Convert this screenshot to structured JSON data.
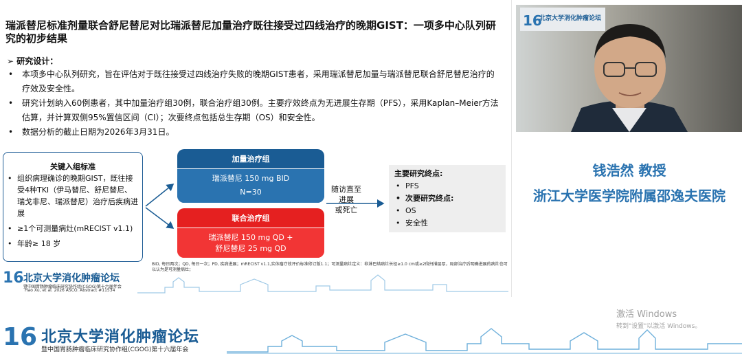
{
  "slide": {
    "title": "瑞派替尼标准剂量联合舒尼替尼对比瑞派替尼加量治疗既往接受过四线治疗的晚期GIST：一项多中心队列研究的初步结果",
    "section_head": "➢ 研究设计：",
    "bullets": [
      "本项多中心队列研究，旨在评估对于既往接受过四线治疗失败的晚期GIST患者，采用瑞派替尼加量与瑞派替尼联合舒尼替尼治疗的疗效及安全性。",
      "研究计划纳入60例患者，其中加量治疗组30例，联合治疗组30例。主要疗效终点为无进展生存期（PFS），采用Kaplan–Meier方法估算，并计算双侧95%置信区间（CI）；次要终点包括总生存期（OS）和安全性。",
      "数据分析的截止日期为2026年3月31日。"
    ],
    "bullet_symbol": "•",
    "criteria": {
      "title": "关键入组标准",
      "items": [
        "组织病理确诊的晚期GIST，既往接受4种TKI（伊马替尼、舒尼替尼、瑞戈非尼、瑞派替尼）治疗后疾病进展",
        "≥1个可测量病灶(mRECIST v1.1)",
        "年龄≥ 18 岁"
      ]
    },
    "arm1": {
      "title": "加量治疗组",
      "line1": "瑞派替尼 150 mg BID",
      "line2": "N=30"
    },
    "arm2": {
      "title": "联合治疗组",
      "line1": "瑞派替尼 150 mg QD +",
      "line2": "舒尼替尼  25 mg QD"
    },
    "follow_up": {
      "line1": "随访直至进展",
      "line2": "或死亡"
    },
    "endpoints": {
      "primary_label": "主要研究终点:",
      "primary": [
        "PFS"
      ],
      "secondary_label": "次要研究终点:",
      "secondary": [
        "OS",
        "安全性"
      ]
    },
    "footnote": "BID, 每日两次；QD, 每日一次；PD, 疾病进展；mRECIST v1.1,实体瘤疗效评价标准修订版1.1；可测量病灶定义：非淋巴结病灶长径≥1.0 cm或≥2倍扫描层厚，局部治疗后明确进展的病灶也可以认为是可测量病灶；",
    "citation": "Hao Xu, et al. 2026 ASCO. Abstract #11534",
    "logo": {
      "number": "16",
      "name": "北京大学消化肿瘤论坛",
      "subtitle": "暨中国胃肠肿瘤临床研究协作组(CGOG)第十六届年会"
    }
  },
  "speaker": {
    "name": "钱浩然 教授",
    "affiliation": "浙江大学医学院附属邵逸夫医院"
  },
  "webcam": {
    "badge": "16",
    "backdrop_title": "北京大学消化肿瘤论坛"
  },
  "windows_watermark": {
    "line1": "激活 Windows",
    "line2": "转到\"设置\"以激活 Windows。"
  },
  "banner": {
    "number": "16",
    "name": "北京大学消化肿瘤论坛",
    "subtitle": "暨中国胃肠肿瘤临床研究协作组(CGOG)第十六届年会"
  },
  "colors": {
    "brand_blue": "#1a5c94",
    "arm_red": "#e52020",
    "speaker_blue": "#2a73b0"
  }
}
